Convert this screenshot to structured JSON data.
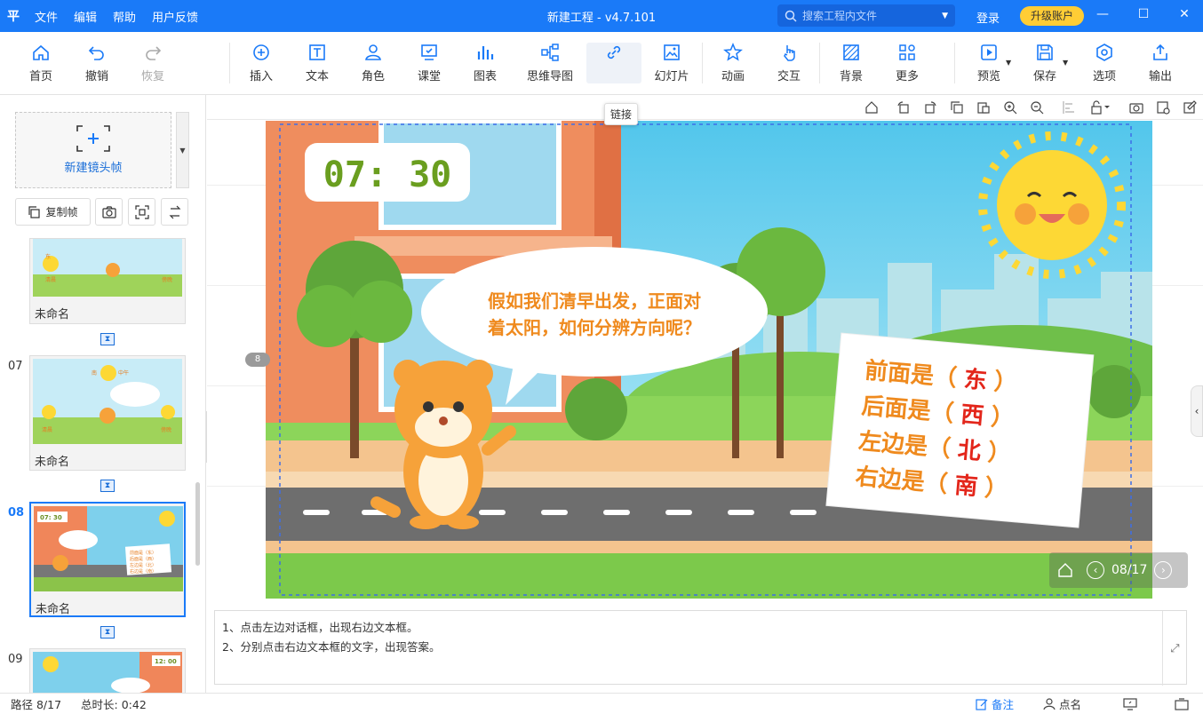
{
  "app": {
    "logo": "平",
    "menus": [
      "文件",
      "编辑",
      "帮助",
      "用户反馈"
    ],
    "title": "新建工程 - v4.7.101",
    "search_placeholder": "搜索工程内文件",
    "login": "登录",
    "upgrade": "升级账户",
    "accent": "#1a7af8"
  },
  "toolbar": {
    "home": "首页",
    "undo": "撤销",
    "redo": "恢复",
    "insert": "插入",
    "text": "文本",
    "role": "角色",
    "classroom": "课堂",
    "chart": "图表",
    "mindmap": "思维导图",
    "link": "链接",
    "slideshow": "幻灯片",
    "animation": "动画",
    "interaction": "交互",
    "background": "背景",
    "more": "更多",
    "preview": "预览",
    "save": "保存",
    "options": "选项",
    "export": "输出",
    "tooltip": "链接"
  },
  "left_panel": {
    "new_frame": "新建镜头帧",
    "copy_frame": "复制帧",
    "slides": [
      {
        "num": "",
        "label": "未命名"
      },
      {
        "num": "07",
        "label": "未命名"
      },
      {
        "num": "08",
        "label": "未命名"
      },
      {
        "num": "09",
        "label": ""
      }
    ]
  },
  "slide": {
    "time": "07: 30",
    "bubble": "假如我们清早出发，正面对着太阳，如何分辨方向呢？",
    "rows": [
      {
        "prefix": "前面是（",
        "answer": "东",
        "suffix": "）"
      },
      {
        "prefix": "后面是（",
        "answer": "西",
        "suffix": "）"
      },
      {
        "prefix": "左边是（",
        "answer": "北",
        "suffix": "）"
      },
      {
        "prefix": "右边是（",
        "answer": "南",
        "suffix": "）"
      }
    ],
    "badge": "8",
    "page_indicator": "08/17"
  },
  "thumbs": {
    "t07_top": "南",
    "t07_mid": "中午",
    "t08_time": "07: 30",
    "t09_time": "12: 00",
    "t_left_word": "清晨",
    "t_right_word": "傍晚"
  },
  "notes": {
    "line1": "1、点击左边对话框，出现右边文本框。",
    "line2": "2、分别点击右边文本框的文字，出现答案。"
  },
  "status": {
    "path": "路径 8/17",
    "duration": "总时长: 0:42",
    "notes": "备注",
    "roll_call": "点名"
  }
}
